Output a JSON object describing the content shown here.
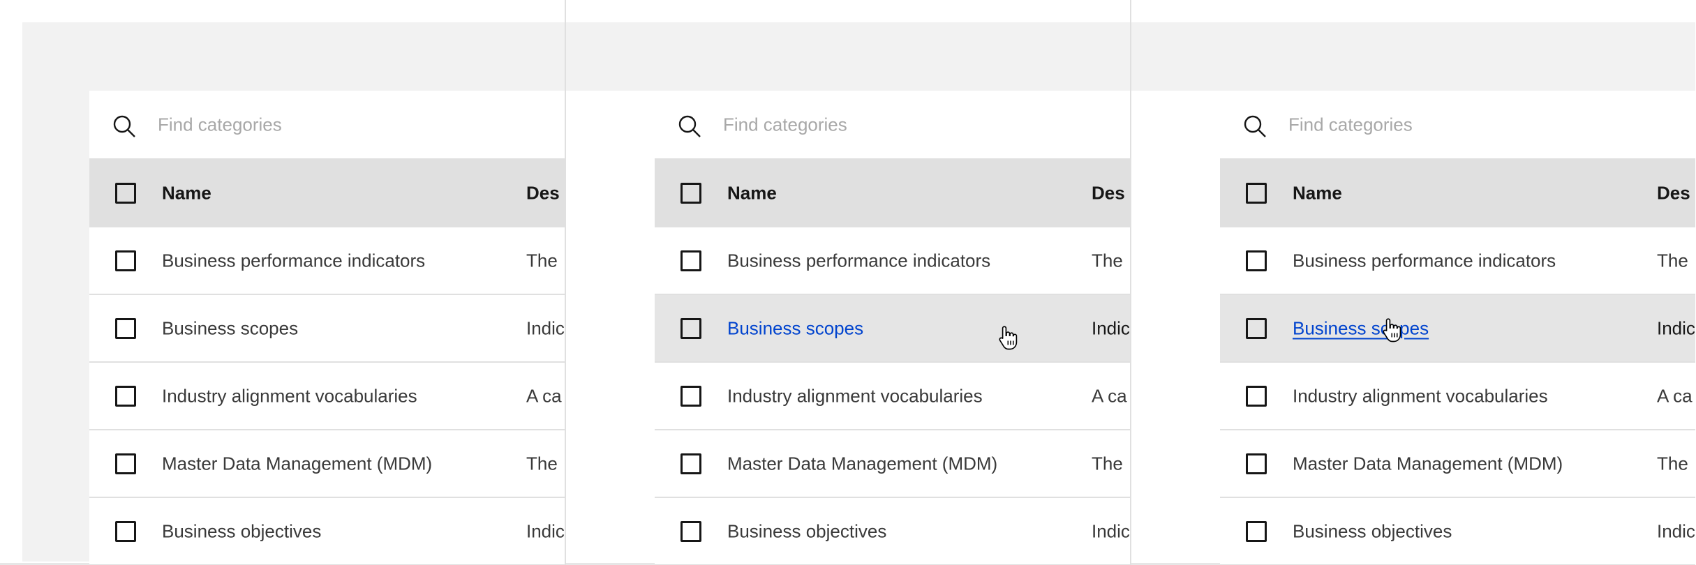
{
  "search": {
    "placeholder": "Find categories"
  },
  "table": {
    "headers": {
      "name": "Name",
      "description": "Des"
    },
    "rows": [
      {
        "name": "Business performance indicators",
        "description": "The"
      },
      {
        "name": "Business scopes",
        "description": "Indic"
      },
      {
        "name": "Industry alignment vocabularies",
        "description": "A ca"
      },
      {
        "name": "Master Data Management (MDM)",
        "description": "The"
      },
      {
        "name": "Business objectives",
        "description": "Indic"
      }
    ]
  },
  "panels": [
    {
      "state": "default",
      "hovered_row": null,
      "link_underlined": false
    },
    {
      "state": "row-hover",
      "hovered_row": 1,
      "link_underlined": false
    },
    {
      "state": "link-hover",
      "hovered_row": 1,
      "link_underlined": true
    }
  ],
  "colors": {
    "link": "#0043ce",
    "hover_row": "#e5e5e5",
    "header": "#e0e0e0",
    "background": "#f2f2f2"
  }
}
